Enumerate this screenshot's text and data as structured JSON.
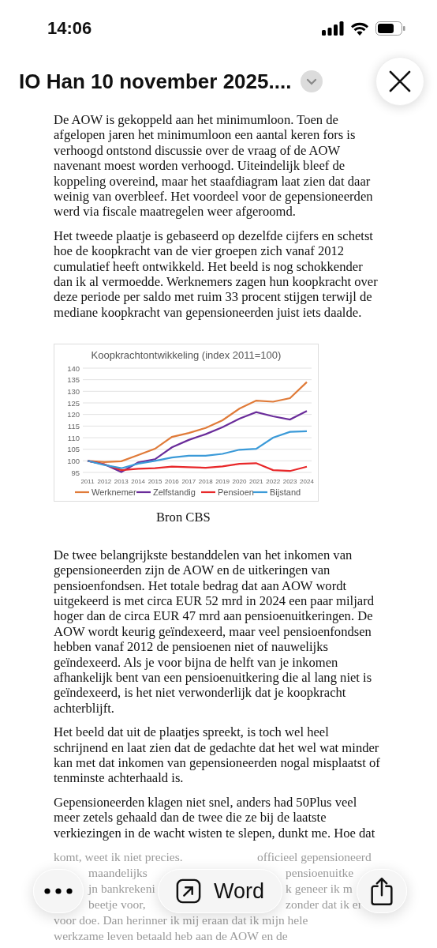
{
  "status_bar": {
    "time": "14:06"
  },
  "header": {
    "title": "IO Han 10 november 2025...."
  },
  "document": {
    "paragraphs": [
      [
        "De AOW is gekoppeld aan het minimumloon. Toen de",
        "afgelopen jaren het minimumloon een aantal keren fors is",
        "verhoogd ontstond discussie over de vraag of de AOW",
        "navenant moest worden verhoogd. Uiteindelijk bleef de",
        "koppeling overeind, maar het staafdiagram laat zien dat daar",
        "weinig van overbleef. Het voordeel voor de gepensioneerden",
        "werd via fiscale maatregelen weer afgeroomd."
      ],
      [
        "Het tweede plaatje is gebaseerd op dezelfde cijfers en schetst",
        "hoe de koopkracht van de vier groepen zich vanaf 2012",
        "cumulatief heeft ontwikkeld. Het beeld is nog schokkender",
        "dan ik al vermoedde. Werknemers zagen hun koopkracht over",
        "deze periode per saldo met ruim 33 procent stijgen terwijl de",
        "mediane koopkracht van gepensioneerden juist iets daalde."
      ]
    ],
    "figure": {
      "caption": "Bron CBS",
      "chart_data": {
        "type": "line",
        "title": "Koopkrachtontwikkeling (index 2011=100)",
        "categories": [
          "2011",
          "2012",
          "2013",
          "2014",
          "2015",
          "2016",
          "2017",
          "2018",
          "2019",
          "2020",
          "2021",
          "2022",
          "2023",
          "2024"
        ],
        "ylim": [
          95,
          140
        ],
        "yticks": [
          95,
          100,
          105,
          110,
          115,
          120,
          125,
          130,
          135,
          140
        ],
        "grid": true,
        "legend": "bottom",
        "series": [
          {
            "name": "Werknemer",
            "color": "#e07b39",
            "values": [
              100,
              99.5,
              99.8,
              102.5,
              105.2,
              110.3,
              112,
              114.2,
              117.5,
              122.5,
              126,
              125.5,
              127,
              134
            ]
          },
          {
            "name": "Zelfstandig",
            "color": "#6a2c9a",
            "values": [
              100,
              98.5,
              95.2,
              99.3,
              100.7,
              105.8,
              109,
              111.5,
              114.5,
              118.2,
              121,
              119.2,
              117.8,
              121.5
            ]
          },
          {
            "name": "Pensioen",
            "color": "#e8282a",
            "values": [
              100,
              98.5,
              96,
              96.6,
              96.8,
              97.5,
              97.3,
              97,
              97.6,
              98.7,
              99,
              96,
              95.6,
              97.5
            ]
          },
          {
            "name": "Bijstand",
            "color": "#3b9ad8",
            "values": [
              100,
              98.2,
              96.8,
              98.8,
              100,
              101.4,
              102.2,
              102.2,
              103,
              104.8,
              105.2,
              110,
              112.5,
              112.8
            ]
          }
        ]
      }
    },
    "paragraphs_after": [
      [
        "De twee belangrijkste bestanddelen van het inkomen van",
        "gepensioneerden zijn de AOW en de uitkeringen van",
        "pensioenfondsen. Het totale bedrag dat aan AOW wordt",
        "uitgekeerd is met circa EUR 52 mrd in 2024 een paar miljard",
        "hoger dan de circa EUR 47 mrd aan pensioenuitkeringen. De",
        "AOW wordt keurig geïndexeerd, maar veel pensioenfondsen",
        "hebben vanaf 2012 de pensioenen niet of nauwelijks",
        "geïndexeerd. Als je voor bijna de helft van je inkomen",
        "afhankelijk bent van een pensioenuitkering die al lang niet is",
        "geïndexeerd, is het niet verwonderlijk dat je koopkracht",
        "achterblijft."
      ],
      [
        "Het beeld dat uit de plaatjes spreekt, is toch wel heel",
        "schrijnend en laat zien dat de gedachte dat het wel wat minder",
        "kan met dat inkomen van gepensioneerden nogal misplaatst of",
        "tenminste achterhaald is."
      ],
      [
        "Gepensioneerden klagen niet snel, anders had 50Plus veel",
        "meer zetels gehaald dan de twee die ze bij de laatste",
        "verkiezingen in de wacht wisten te slepen, dunkt me. Hoe dat"
      ]
    ],
    "faded_lines": [
      [
        "komt, weet ik niet precies.",
        "officieel gepensioneerd"
      ],
      [
        "maandelijks",
        "pensioenuitke"
      ],
      [
        "jn bankrekeni",
        "k geneer ik m"
      ],
      [
        "beetje voor,",
        "zonder dat ik er"
      ],
      [
        "voor doe. Dan herinner ik mij eraan dat ik mijn hele"
      ],
      [
        "werkzame leven betaald heb aan de AOW en de"
      ]
    ]
  },
  "toolbar": {
    "open_button": "Word"
  }
}
